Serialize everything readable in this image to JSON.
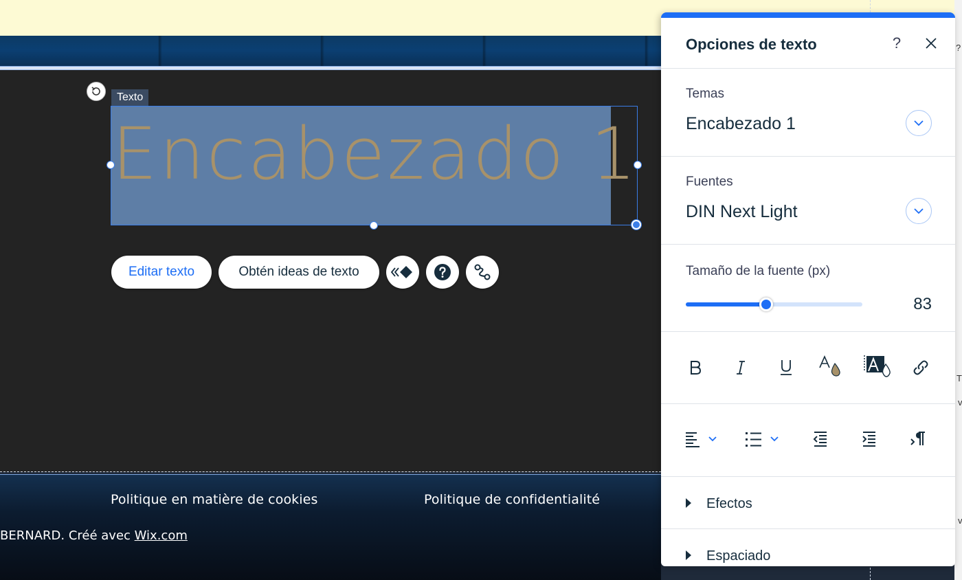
{
  "page": {
    "element_tag": "Texto",
    "heading": "Encabezado 1",
    "footer_links": [
      "Politique en matière de cookies",
      "Politique de confidentialité"
    ],
    "footer_credit_prefix": "BERNARD. Créé avec ",
    "footer_credit_link": "Wix.com"
  },
  "floating_toolbar": {
    "edit_text": "Editar texto",
    "get_ideas": "Obtén ideas de texto",
    "animation_icon": "animation-icon",
    "help_icon": "help-icon",
    "connect_icon": "connect-icon"
  },
  "panel": {
    "title": "Opciones de texto",
    "help": "?",
    "themes_label": "Temas",
    "themes_value": "Encabezado 1",
    "fonts_label": "Fuentes",
    "fonts_value": "DIN Next Light",
    "font_size_label": "Tamaño de la fuente (px)",
    "font_size_value": "83",
    "font_size_slider_fraction": 0.455,
    "format_tools": [
      "bold-icon",
      "italic-icon",
      "underline-icon",
      "text-color-icon",
      "highlight-icon",
      "link-icon"
    ],
    "layout_tools": [
      "align-left-icon",
      "bullet-list-icon",
      "decrease-indent-icon",
      "increase-indent-icon",
      "text-direction-icon"
    ],
    "accordions": [
      "Efectos",
      "Espaciado"
    ]
  },
  "edge": {
    "chars": [
      "?",
      "T",
      "v",
      "v"
    ]
  },
  "colors": {
    "accent": "#1d6ef5",
    "heading_text": "#a8926a",
    "selection_fill": "#5e7ea6",
    "dark_section": "#232323",
    "top_banner": "#fdfad4"
  }
}
